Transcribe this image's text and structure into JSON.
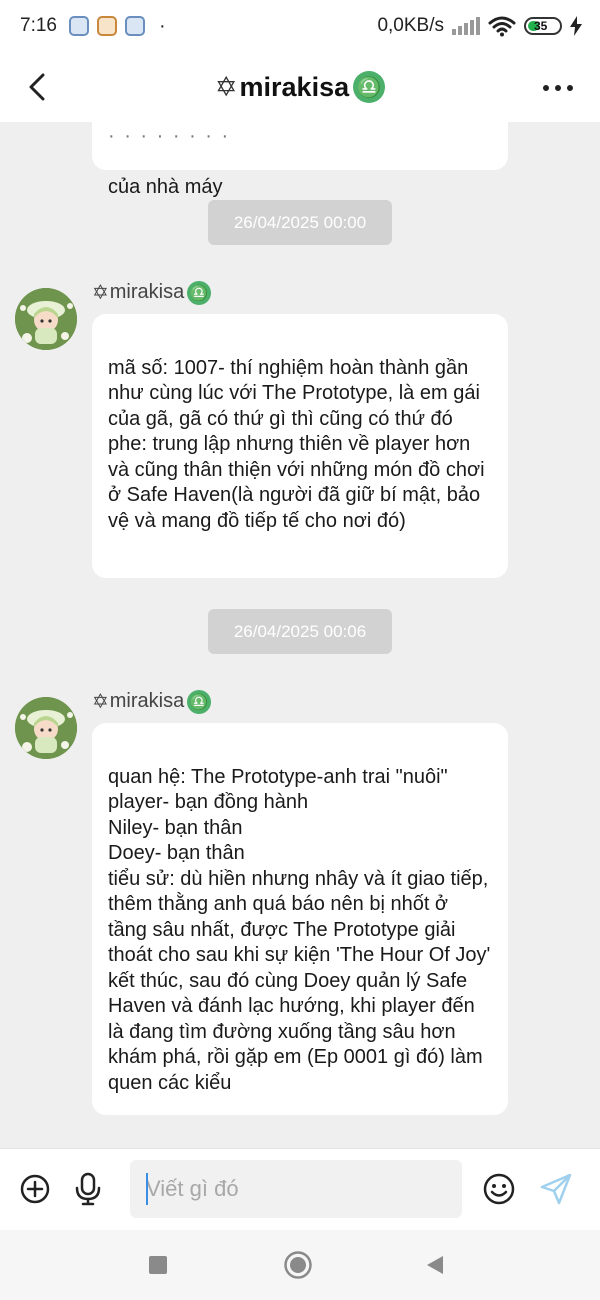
{
  "status_bar": {
    "time": "7:16",
    "network_speed": "0,0KB/s",
    "battery_percent": "35",
    "battery_level": 0.35,
    "dot": "·"
  },
  "header": {
    "prefix": "✡",
    "name": "mirakisa",
    "zodiac": "♎"
  },
  "chat": {
    "previous_message_tail": "của nhà máy",
    "messages": [
      {
        "timestamp": "26/04/2025 00:00",
        "sender_prefix": "✡",
        "sender_name": "mirakisa",
        "sender_zodiac": "♎",
        "text": "mã số: 1007- thí nghiệm hoàn thành gần như cùng lúc với The Prototype, là em gái của gã, gã có thứ gì thì cũng có thứ đó\nphe: trung lập nhưng thiên về player hơn và cũng thân thiện với những món đồ chơi ở Safe Haven(là người đã giữ bí mật, bảo vệ và mang đồ tiếp tế cho nơi đó)"
      },
      {
        "timestamp": "26/04/2025 00:06",
        "sender_prefix": "✡",
        "sender_name": "mirakisa",
        "sender_zodiac": "♎",
        "text": "quan hệ: The Prototype-anh trai \"nuôi\"\nplayer- bạn đồng hành\nNiley- bạn thân\nDoey- bạn thân\ntiểu sử: dù hiền nhưng nhây và ít giao tiếp, thêm thằng anh quá báo nên bị nhốt ở tầng sâu nhất, được The Prototype giải thoát cho sau khi sự kiện 'The Hour Of Joy' kết thúc, sau đó cùng Doey quản lý Safe Haven và đánh lạc hướng, khi player đến là đang tìm đường xuống tầng sâu hơn khám phá, rồi gặp em (Ep 0001 gì đó) làm quen các kiểu"
      }
    ]
  },
  "input": {
    "placeholder": "Viết gì đó",
    "value": ""
  },
  "icons": {
    "back": "chevron-left-icon",
    "more": "more-dots-icon",
    "add": "plus-circle-icon",
    "mic": "microphone-icon",
    "emoji": "smiley-icon",
    "send": "send-icon"
  },
  "colors": {
    "background": "#efefef",
    "bubble": "#ffffff",
    "timestamp_pill": "#d2d2d2",
    "zodiac_badge": "#4caf6a",
    "battery_fill": "#22b14c",
    "send_icon": "#9fd0ee"
  }
}
